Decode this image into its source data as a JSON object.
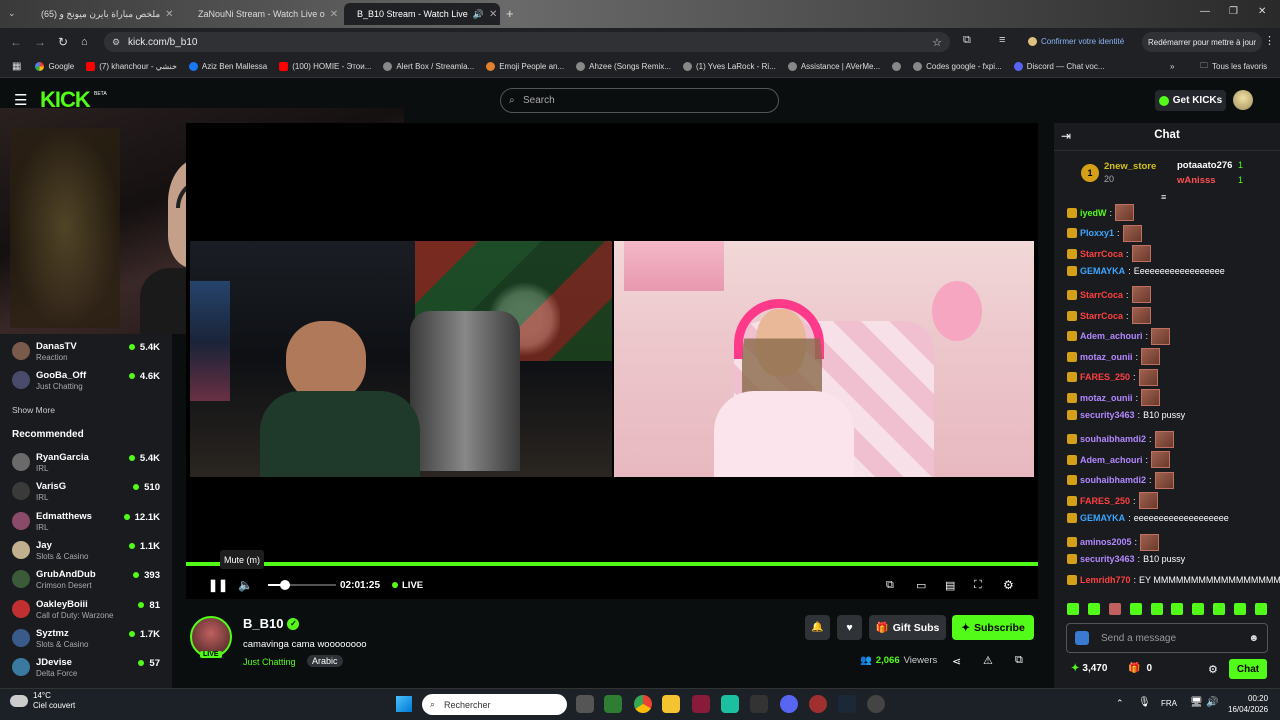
{
  "browser": {
    "tabs": [
      {
        "label": "ملخص مباراة بايرن ميونخ و (65)",
        "icon_color": "#ff0000"
      },
      {
        "label": "ZaNouNi Stream - Watch Live o",
        "icon_color": "#53fc18"
      },
      {
        "label": "B_B10 Stream - Watch Live",
        "icon_color": "#53fc18"
      }
    ],
    "url": "kick.com/b_b10",
    "identity": "Confirmer votre identité",
    "restart": "Redémarrer pour mettre à jour",
    "bookmarks": [
      "Google",
      "(7) khanchour - خنشي",
      "Aziz Ben Mallessa",
      "(100) HOMIE - Этои...",
      "Alert Box / Streamla...",
      "Emoji People an...",
      "Ahzee (Songs Remix...",
      "(1) Yves LaRock - Ri...",
      "Assistance | AVerMe...",
      "Codes google - fxpi...",
      "Discord — Chat voc..."
    ],
    "bookmarks_all": "Tous les favoris"
  },
  "kick": {
    "logo": "KICK",
    "beta": "BETA",
    "search_placeholder": "Search",
    "get_kicks": "Get KICKs"
  },
  "sidebar": {
    "following": [
      {
        "name": "DanasTV",
        "category": "Reaction",
        "viewers": "5.4K",
        "color": "#7a5a4a"
      },
      {
        "name": "GooBa_Off",
        "category": "Just Chatting",
        "viewers": "4.6K",
        "color": "#4a4a6a"
      }
    ],
    "show_more": "Show More",
    "recommended_title": "Recommended",
    "recommended": [
      {
        "name": "RyanGarcia",
        "category": "IRL",
        "viewers": "5.4K",
        "color": "#6a6a6a"
      },
      {
        "name": "VarisG",
        "category": "IRL",
        "viewers": "510",
        "color": "#3a3a3a"
      },
      {
        "name": "Edmatthews",
        "category": "IRL",
        "viewers": "12.1K",
        "color": "#8a4a6a"
      },
      {
        "name": "Jay",
        "category": "Slots & Casino",
        "viewers": "1.1K",
        "color": "#c0b090"
      },
      {
        "name": "GrubAndDub",
        "category": "Crimson Desert",
        "viewers": "393",
        "color": "#3a5a3a"
      },
      {
        "name": "OakleyBoiii",
        "category": "Call of Duty: Warzone",
        "viewers": "81",
        "color": "#c03030"
      },
      {
        "name": "Syztmz",
        "category": "Slots & Casino",
        "viewers": "1.7K",
        "color": "#3a5a8a"
      },
      {
        "name": "JDevise",
        "category": "Delta Force",
        "viewers": "57",
        "color": "#3a7aa0"
      }
    ]
  },
  "player": {
    "tooltip": "Mute (m)",
    "time": "02:01:25",
    "live": "LIVE",
    "progress": 0.0
  },
  "stream": {
    "streamer": "B_B10",
    "title": "camavinga cama woooooooo",
    "category": "Just Chatting",
    "tag": "Arabic",
    "live_badge": "LIVE",
    "viewers": "2,066",
    "viewers_label": "Viewers",
    "gift_subs": "Gift Subs",
    "subscribe": "Subscribe"
  },
  "chat": {
    "title": "Chat",
    "leaders": [
      {
        "rank": "1",
        "name": "2new_store",
        "count": "20"
      },
      {
        "name": "potaaato276",
        "count": "1"
      },
      {
        "name": "wAnisss",
        "count": "1"
      }
    ],
    "messages": [
      {
        "user": "iyedW",
        "color": "#53fc18",
        "text": "",
        "emote": true
      },
      {
        "user": "Ploxxy1",
        "color": "#3ea6ff",
        "text": "",
        "emote": true
      },
      {
        "user": "StarrCoca",
        "color": "#ff4040",
        "text": "",
        "emote": true
      },
      {
        "user": "GEMAYKA",
        "color": "#3ea6ff",
        "text": "Eeeeeeeeeeeeeeeeee",
        "emote": false
      },
      {
        "user": "StarrCoca",
        "color": "#ff4040",
        "text": "",
        "emote": true
      },
      {
        "user": "StarrCoca",
        "color": "#ff4040",
        "text": "",
        "emote": true
      },
      {
        "user": "Adem_achouri",
        "color": "#b388ff",
        "text": "",
        "emote": true
      },
      {
        "user": "motaz_ounii",
        "color": "#b388ff",
        "text": "",
        "emote": true
      },
      {
        "user": "FARES_250",
        "color": "#ff4040",
        "text": "",
        "emote": true
      },
      {
        "user": "motaz_ounii",
        "color": "#b388ff",
        "text": "",
        "emote": true
      },
      {
        "user": "security3463",
        "color": "#b388ff",
        "text": "B10 pussy",
        "emote": false
      },
      {
        "user": "souhaibhamdi2",
        "color": "#b388ff",
        "text": "",
        "emote": true
      },
      {
        "user": "Adem_achouri",
        "color": "#b388ff",
        "text": "",
        "emote": true
      },
      {
        "user": "souhaibhamdi2",
        "color": "#b388ff",
        "text": "",
        "emote": true
      },
      {
        "user": "FARES_250",
        "color": "#ff4040",
        "text": "",
        "emote": true
      },
      {
        "user": "GEMAYKA",
        "color": "#3ea6ff",
        "text": "eeeeeeeeeeeeeeeeeee",
        "emote": false
      },
      {
        "user": "aminos2005",
        "color": "#b388ff",
        "text": "",
        "emote": true
      },
      {
        "user": "security3463",
        "color": "#b388ff",
        "text": "B10 pussy",
        "emote": false
      },
      {
        "user": "Lemridh770",
        "color": "#ff4040",
        "text": "EY MMMMMMMMMMMMMMMMM",
        "emote": false
      }
    ],
    "input_placeholder": "Send a message",
    "points": "3,470",
    "gifts": "0",
    "send": "Chat"
  },
  "taskbar": {
    "weather_temp": "14°C",
    "weather_desc": "Ciel couvert",
    "search_placeholder": "Rechercher",
    "lang": "FRA",
    "time": "00:20",
    "date": "16/04/2026"
  }
}
